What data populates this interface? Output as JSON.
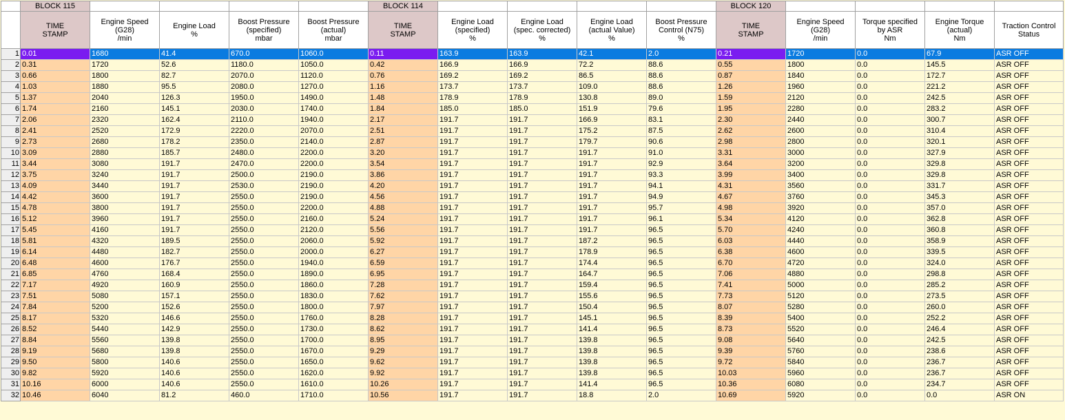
{
  "blocks": [
    {
      "label": "BLOCK 115"
    },
    {
      "label": "BLOCK 114"
    },
    {
      "label": "BLOCK 120"
    }
  ],
  "headers": [
    {
      "lines": [
        "TIME",
        "STAMP"
      ],
      "ts": true
    },
    {
      "lines": [
        "Engine Speed",
        "(G28)",
        "/min"
      ]
    },
    {
      "lines": [
        "Engine Load",
        "",
        "%"
      ]
    },
    {
      "lines": [
        "Boost Pressure",
        "(specified)",
        "mbar"
      ]
    },
    {
      "lines": [
        "Boost Pressure",
        "(actual)",
        "mbar"
      ]
    },
    {
      "lines": [
        "TIME",
        "STAMP"
      ],
      "ts": true
    },
    {
      "lines": [
        "Engine Load",
        "(specified)",
        "%"
      ]
    },
    {
      "lines": [
        "Engine Load",
        "(spec. corrected)",
        "%"
      ]
    },
    {
      "lines": [
        "Engine Load",
        "(actual Value)",
        "%"
      ]
    },
    {
      "lines": [
        "Boost Pressure",
        "Control (N75)",
        "%"
      ]
    },
    {
      "lines": [
        "TIME",
        "STAMP"
      ],
      "ts": true
    },
    {
      "lines": [
        "Engine Speed",
        "(G28)",
        "/min"
      ]
    },
    {
      "lines": [
        "Torque specified",
        "by ASR",
        "Nm"
      ]
    },
    {
      "lines": [
        "Engine Torque",
        "(actual)",
        "Nm"
      ]
    },
    {
      "lines": [
        "Traction Control",
        "Status"
      ]
    }
  ],
  "colors": {
    "background": "#fffad6",
    "timestamp_cell": "#ffd5a6",
    "timestamp_header": "#ddc8c8",
    "selected_row": "#0a7be0",
    "selected_timestamp": "#7a1cf0"
  },
  "selected_row": 1,
  "rows": [
    [
      "1",
      "0.01",
      "1680",
      "41.4",
      "670.0",
      "1060.0",
      "0.11",
      "163.9",
      "163.9",
      "42.1",
      "2.0",
      "0.21",
      "1720",
      "0.0",
      "67.9",
      "ASR OFF"
    ],
    [
      "2",
      "0.31",
      "1720",
      "52.6",
      "1180.0",
      "1050.0",
      "0.42",
      "166.9",
      "166.9",
      "72.2",
      "88.6",
      "0.55",
      "1800",
      "0.0",
      "145.5",
      "ASR OFF"
    ],
    [
      "3",
      "0.66",
      "1800",
      "82.7",
      "2070.0",
      "1120.0",
      "0.76",
      "169.2",
      "169.2",
      "86.5",
      "88.6",
      "0.87",
      "1840",
      "0.0",
      "172.7",
      "ASR OFF"
    ],
    [
      "4",
      "1.03",
      "1880",
      "95.5",
      "2080.0",
      "1270.0",
      "1.16",
      "173.7",
      "173.7",
      "109.0",
      "88.6",
      "1.26",
      "1960",
      "0.0",
      "221.2",
      "ASR OFF"
    ],
    [
      "5",
      "1.37",
      "2040",
      "126.3",
      "1950.0",
      "1490.0",
      "1.48",
      "178.9",
      "178.9",
      "130.8",
      "89.0",
      "1.59",
      "2120",
      "0.0",
      "242.5",
      "ASR OFF"
    ],
    [
      "6",
      "1.74",
      "2160",
      "145.1",
      "2030.0",
      "1740.0",
      "1.84",
      "185.0",
      "185.0",
      "151.9",
      "79.6",
      "1.95",
      "2280",
      "0.0",
      "283.2",
      "ASR OFF"
    ],
    [
      "7",
      "2.06",
      "2320",
      "162.4",
      "2110.0",
      "1940.0",
      "2.17",
      "191.7",
      "191.7",
      "166.9",
      "83.1",
      "2.30",
      "2440",
      "0.0",
      "300.7",
      "ASR OFF"
    ],
    [
      "8",
      "2.41",
      "2520",
      "172.9",
      "2220.0",
      "2070.0",
      "2.51",
      "191.7",
      "191.7",
      "175.2",
      "87.5",
      "2.62",
      "2600",
      "0.0",
      "310.4",
      "ASR OFF"
    ],
    [
      "9",
      "2.73",
      "2680",
      "178.2",
      "2350.0",
      "2140.0",
      "2.87",
      "191.7",
      "191.7",
      "179.7",
      "90.6",
      "2.98",
      "2800",
      "0.0",
      "320.1",
      "ASR OFF"
    ],
    [
      "10",
      "3.09",
      "2880",
      "185.7",
      "2480.0",
      "2200.0",
      "3.20",
      "191.7",
      "191.7",
      "191.7",
      "91.0",
      "3.31",
      "3000",
      "0.0",
      "327.9",
      "ASR OFF"
    ],
    [
      "11",
      "3.44",
      "3080",
      "191.7",
      "2470.0",
      "2200.0",
      "3.54",
      "191.7",
      "191.7",
      "191.7",
      "92.9",
      "3.64",
      "3200",
      "0.0",
      "329.8",
      "ASR OFF"
    ],
    [
      "12",
      "3.75",
      "3240",
      "191.7",
      "2500.0",
      "2190.0",
      "3.86",
      "191.7",
      "191.7",
      "191.7",
      "93.3",
      "3.99",
      "3400",
      "0.0",
      "329.8",
      "ASR OFF"
    ],
    [
      "13",
      "4.09",
      "3440",
      "191.7",
      "2530.0",
      "2190.0",
      "4.20",
      "191.7",
      "191.7",
      "191.7",
      "94.1",
      "4.31",
      "3560",
      "0.0",
      "331.7",
      "ASR OFF"
    ],
    [
      "14",
      "4.42",
      "3600",
      "191.7",
      "2550.0",
      "2190.0",
      "4.56",
      "191.7",
      "191.7",
      "191.7",
      "94.9",
      "4.67",
      "3760",
      "0.0",
      "345.3",
      "ASR OFF"
    ],
    [
      "15",
      "4.78",
      "3800",
      "191.7",
      "2550.0",
      "2200.0",
      "4.88",
      "191.7",
      "191.7",
      "191.7",
      "95.7",
      "4.98",
      "3920",
      "0.0",
      "357.0",
      "ASR OFF"
    ],
    [
      "16",
      "5.12",
      "3960",
      "191.7",
      "2550.0",
      "2160.0",
      "5.24",
      "191.7",
      "191.7",
      "191.7",
      "96.1",
      "5.34",
      "4120",
      "0.0",
      "362.8",
      "ASR OFF"
    ],
    [
      "17",
      "5.45",
      "4160",
      "191.7",
      "2550.0",
      "2120.0",
      "5.56",
      "191.7",
      "191.7",
      "191.7",
      "96.5",
      "5.70",
      "4240",
      "0.0",
      "360.8",
      "ASR OFF"
    ],
    [
      "18",
      "5.81",
      "4320",
      "189.5",
      "2550.0",
      "2060.0",
      "5.92",
      "191.7",
      "191.7",
      "187.2",
      "96.5",
      "6.03",
      "4440",
      "0.0",
      "358.9",
      "ASR OFF"
    ],
    [
      "19",
      "6.14",
      "4480",
      "182.7",
      "2550.0",
      "2000.0",
      "6.27",
      "191.7",
      "191.7",
      "178.9",
      "96.5",
      "6.38",
      "4600",
      "0.0",
      "339.5",
      "ASR OFF"
    ],
    [
      "20",
      "6.48",
      "4600",
      "176.7",
      "2550.0",
      "1940.0",
      "6.59",
      "191.7",
      "191.7",
      "174.4",
      "96.5",
      "6.70",
      "4720",
      "0.0",
      "324.0",
      "ASR OFF"
    ],
    [
      "21",
      "6.85",
      "4760",
      "168.4",
      "2550.0",
      "1890.0",
      "6.95",
      "191.7",
      "191.7",
      "164.7",
      "96.5",
      "7.06",
      "4880",
      "0.0",
      "298.8",
      "ASR OFF"
    ],
    [
      "22",
      "7.17",
      "4920",
      "160.9",
      "2550.0",
      "1860.0",
      "7.28",
      "191.7",
      "191.7",
      "159.4",
      "96.5",
      "7.41",
      "5000",
      "0.0",
      "285.2",
      "ASR OFF"
    ],
    [
      "23",
      "7.51",
      "5080",
      "157.1",
      "2550.0",
      "1830.0",
      "7.62",
      "191.7",
      "191.7",
      "155.6",
      "96.5",
      "7.73",
      "5120",
      "0.0",
      "273.5",
      "ASR OFF"
    ],
    [
      "24",
      "7.84",
      "5200",
      "152.6",
      "2550.0",
      "1800.0",
      "7.97",
      "191.7",
      "191.7",
      "150.4",
      "96.5",
      "8.07",
      "5280",
      "0.0",
      "260.0",
      "ASR OFF"
    ],
    [
      "25",
      "8.17",
      "5320",
      "146.6",
      "2550.0",
      "1760.0",
      "8.28",
      "191.7",
      "191.7",
      "145.1",
      "96.5",
      "8.39",
      "5400",
      "0.0",
      "252.2",
      "ASR OFF"
    ],
    [
      "26",
      "8.52",
      "5440",
      "142.9",
      "2550.0",
      "1730.0",
      "8.62",
      "191.7",
      "191.7",
      "141.4",
      "96.5",
      "8.73",
      "5520",
      "0.0",
      "246.4",
      "ASR OFF"
    ],
    [
      "27",
      "8.84",
      "5560",
      "139.8",
      "2550.0",
      "1700.0",
      "8.95",
      "191.7",
      "191.7",
      "139.8",
      "96.5",
      "9.08",
      "5640",
      "0.0",
      "242.5",
      "ASR OFF"
    ],
    [
      "28",
      "9.19",
      "5680",
      "139.8",
      "2550.0",
      "1670.0",
      "9.29",
      "191.7",
      "191.7",
      "139.8",
      "96.5",
      "9.39",
      "5760",
      "0.0",
      "238.6",
      "ASR OFF"
    ],
    [
      "29",
      "9.50",
      "5800",
      "140.6",
      "2550.0",
      "1650.0",
      "9.62",
      "191.7",
      "191.7",
      "139.8",
      "96.5",
      "9.72",
      "5840",
      "0.0",
      "236.7",
      "ASR OFF"
    ],
    [
      "30",
      "9.82",
      "5920",
      "140.6",
      "2550.0",
      "1620.0",
      "9.92",
      "191.7",
      "191.7",
      "139.8",
      "96.5",
      "10.03",
      "5960",
      "0.0",
      "236.7",
      "ASR OFF"
    ],
    [
      "31",
      "10.16",
      "6000",
      "140.6",
      "2550.0",
      "1610.0",
      "10.26",
      "191.7",
      "191.7",
      "141.4",
      "96.5",
      "10.36",
      "6080",
      "0.0",
      "234.7",
      "ASR OFF"
    ],
    [
      "32",
      "10.46",
      "6040",
      "81.2",
      "460.0",
      "1710.0",
      "10.56",
      "191.7",
      "191.7",
      "18.8",
      "2.0",
      "10.69",
      "5920",
      "0.0",
      "0.0",
      "ASR ON"
    ]
  ]
}
